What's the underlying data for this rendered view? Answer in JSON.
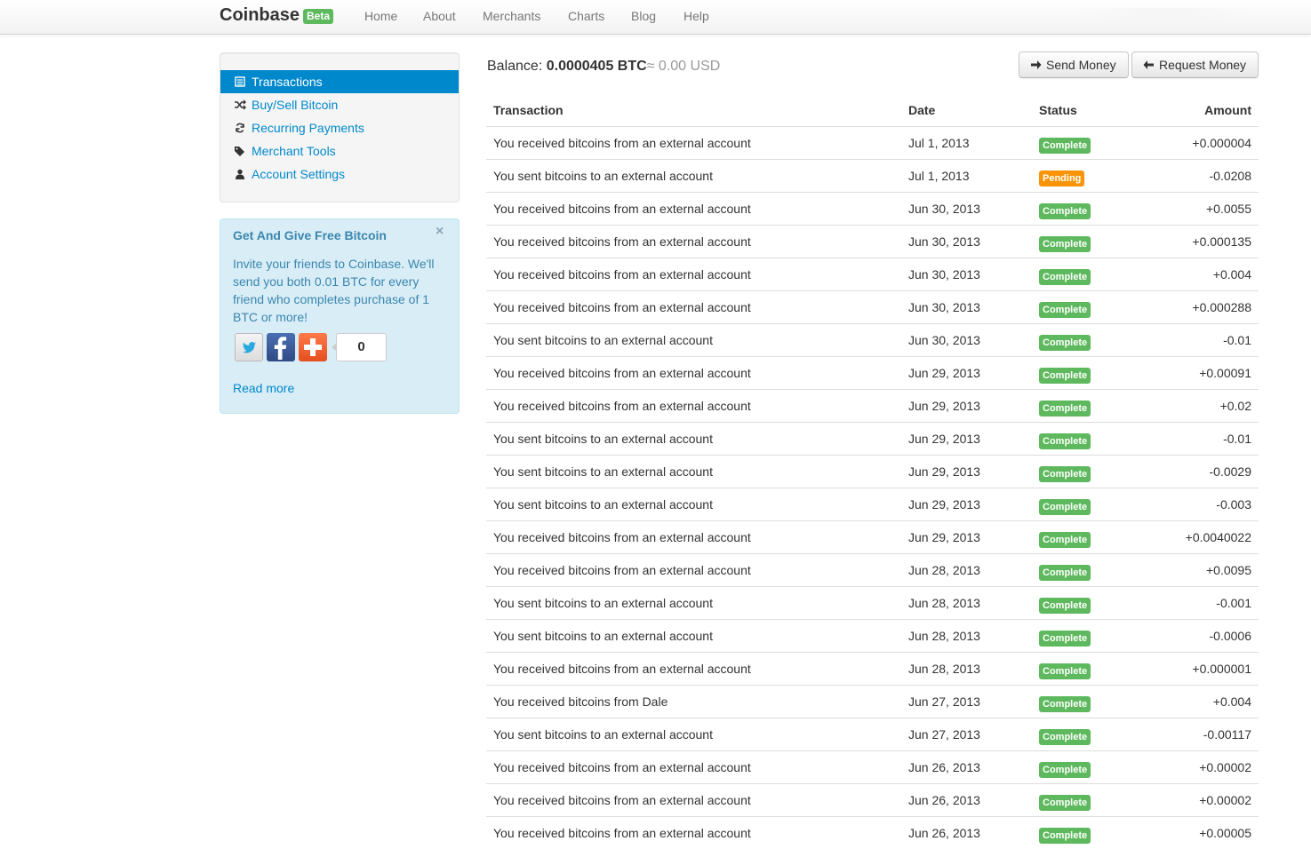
{
  "navbar": {
    "brand": "Coinbase",
    "badge": "Beta",
    "links": [
      "Home",
      "About",
      "Merchants",
      "Charts",
      "Blog",
      "Help"
    ]
  },
  "sidebar": {
    "items": [
      {
        "label": "Transactions",
        "icon": "list-icon",
        "active": true
      },
      {
        "label": "Buy/Sell Bitcoin",
        "icon": "shuffle-icon",
        "active": false
      },
      {
        "label": "Recurring Payments",
        "icon": "refresh-icon",
        "active": false
      },
      {
        "label": "Merchant Tools",
        "icon": "tags-icon",
        "active": false
      },
      {
        "label": "Account Settings",
        "icon": "user-icon",
        "active": false
      }
    ]
  },
  "promo": {
    "title": "Get And Give Free Bitcoin",
    "close": "×",
    "text": "Invite your friends to Coinbase. We'll send you both 0.01 BTC for every friend who completes purchase of 1 BTC or more!",
    "share_count": "0",
    "read_more": "Read more"
  },
  "balance": {
    "label": "Balance:",
    "btc": "0.0000405 BTC",
    "approx": "≈",
    "usd": "0.00 USD"
  },
  "actions": {
    "send": "Send Money",
    "request": "Request Money"
  },
  "colors": {
    "complete": "#5eb95e",
    "pending": "#f89406",
    "link": "#0088cc"
  },
  "table": {
    "headers": [
      "Transaction",
      "Date",
      "Status",
      "Amount"
    ],
    "rows": [
      {
        "tx": "You received bitcoins from an external account",
        "date": "Jul 1, 2013",
        "status": "Complete",
        "amount": "+0.000004"
      },
      {
        "tx": "You sent bitcoins to an external account",
        "date": "Jul 1, 2013",
        "status": "Pending",
        "amount": "-0.0208"
      },
      {
        "tx": "You received bitcoins from an external account",
        "date": "Jun 30, 2013",
        "status": "Complete",
        "amount": "+0.0055"
      },
      {
        "tx": "You received bitcoins from an external account",
        "date": "Jun 30, 2013",
        "status": "Complete",
        "amount": "+0.000135"
      },
      {
        "tx": "You received bitcoins from an external account",
        "date": "Jun 30, 2013",
        "status": "Complete",
        "amount": "+0.004"
      },
      {
        "tx": "You received bitcoins from an external account",
        "date": "Jun 30, 2013",
        "status": "Complete",
        "amount": "+0.000288"
      },
      {
        "tx": "You sent bitcoins to an external account",
        "date": "Jun 30, 2013",
        "status": "Complete",
        "amount": "-0.01"
      },
      {
        "tx": "You received bitcoins from an external account",
        "date": "Jun 29, 2013",
        "status": "Complete",
        "amount": "+0.00091"
      },
      {
        "tx": "You received bitcoins from an external account",
        "date": "Jun 29, 2013",
        "status": "Complete",
        "amount": "+0.02"
      },
      {
        "tx": "You sent bitcoins to an external account",
        "date": "Jun 29, 2013",
        "status": "Complete",
        "amount": "-0.01"
      },
      {
        "tx": "You sent bitcoins to an external account",
        "date": "Jun 29, 2013",
        "status": "Complete",
        "amount": "-0.0029"
      },
      {
        "tx": "You sent bitcoins to an external account",
        "date": "Jun 29, 2013",
        "status": "Complete",
        "amount": "-0.003"
      },
      {
        "tx": "You received bitcoins from an external account",
        "date": "Jun 29, 2013",
        "status": "Complete",
        "amount": "+0.0040022"
      },
      {
        "tx": "You received bitcoins from an external account",
        "date": "Jun 28, 2013",
        "status": "Complete",
        "amount": "+0.0095"
      },
      {
        "tx": "You sent bitcoins to an external account",
        "date": "Jun 28, 2013",
        "status": "Complete",
        "amount": "-0.001"
      },
      {
        "tx": "You sent bitcoins to an external account",
        "date": "Jun 28, 2013",
        "status": "Complete",
        "amount": "-0.0006"
      },
      {
        "tx": "You received bitcoins from an external account",
        "date": "Jun 28, 2013",
        "status": "Complete",
        "amount": "+0.000001"
      },
      {
        "tx": "You received bitcoins from Dale",
        "date": "Jun 27, 2013",
        "status": "Complete",
        "amount": "+0.004"
      },
      {
        "tx": "You sent bitcoins to an external account",
        "date": "Jun 27, 2013",
        "status": "Complete",
        "amount": "-0.00117"
      },
      {
        "tx": "You received bitcoins from an external account",
        "date": "Jun 26, 2013",
        "status": "Complete",
        "amount": "+0.00002"
      },
      {
        "tx": "You received bitcoins from an external account",
        "date": "Jun 26, 2013",
        "status": "Complete",
        "amount": "+0.00002"
      },
      {
        "tx": "You received bitcoins from an external account",
        "date": "Jun 26, 2013",
        "status": "Complete",
        "amount": "+0.00005"
      }
    ]
  }
}
